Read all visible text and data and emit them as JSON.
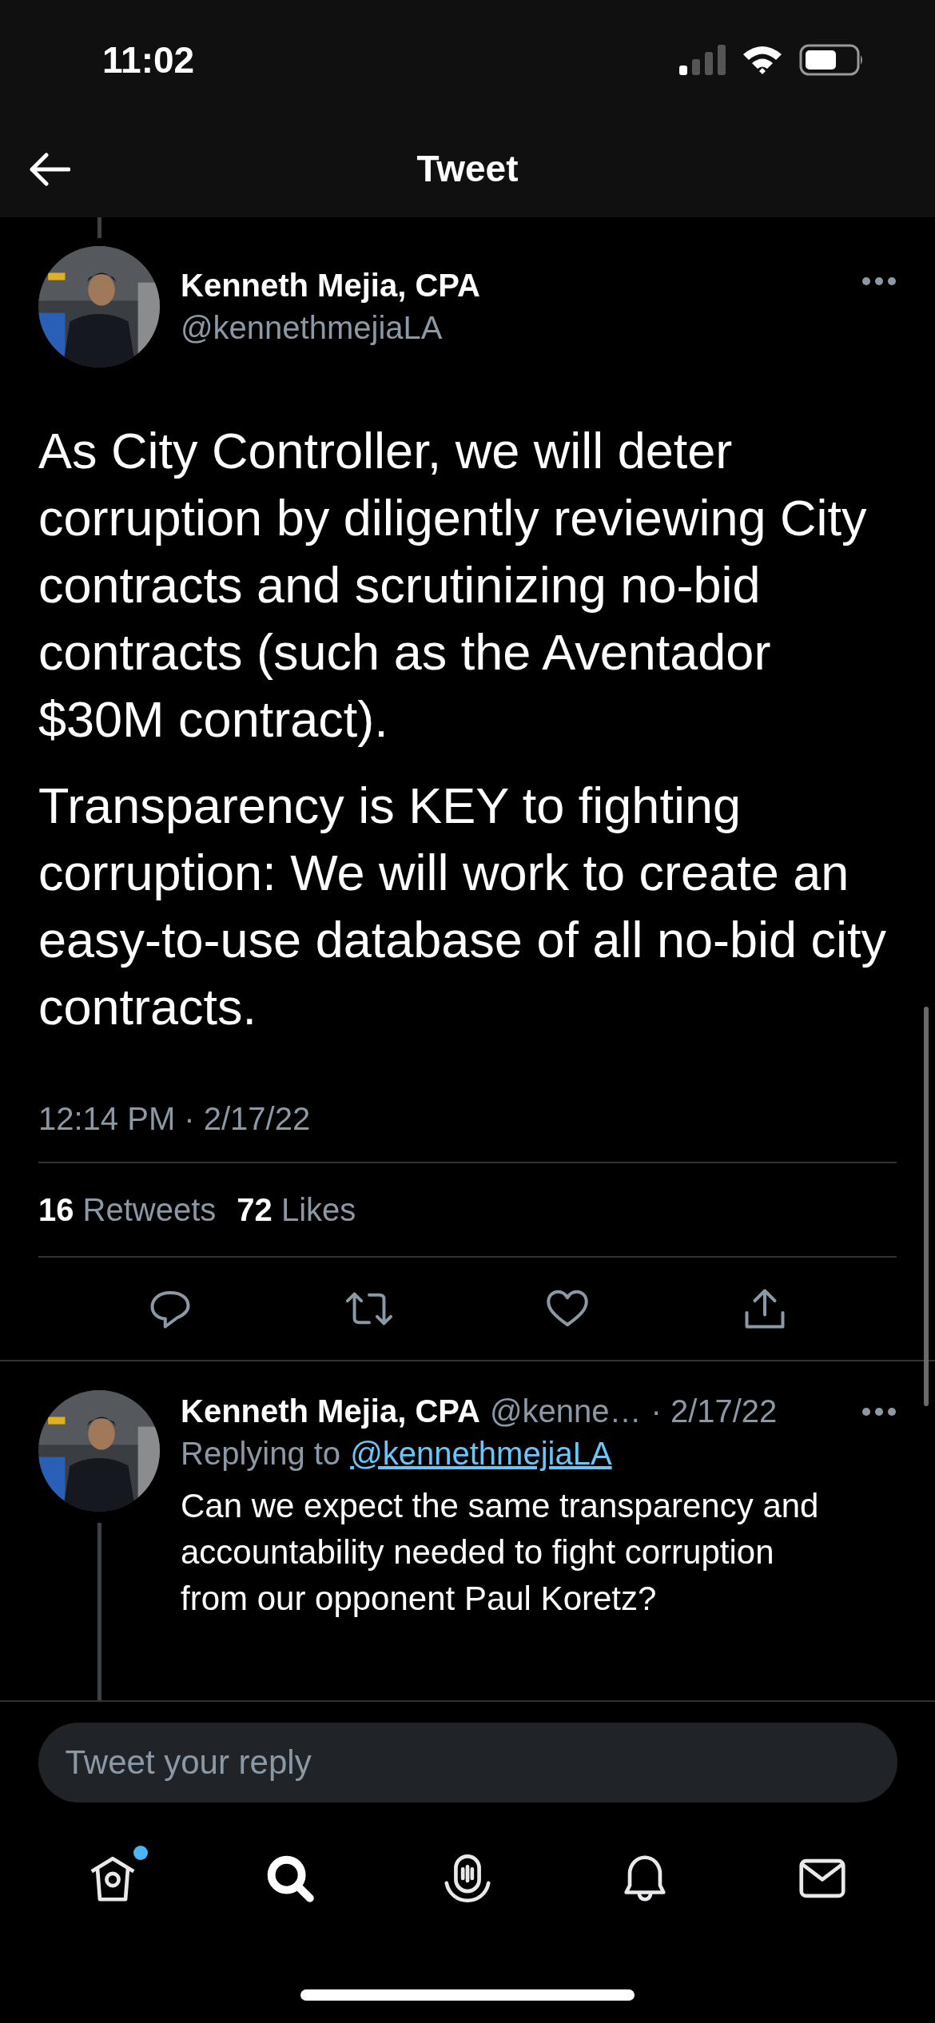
{
  "status_bar": {
    "time": "11:02"
  },
  "header": {
    "title": "Tweet"
  },
  "tweet": {
    "author": "Kenneth Mejia, CPA",
    "handle": "@kennethmejiaLA",
    "paragraphs": [
      "As City Controller, we will deter corruption by diligently reviewing City contracts and scrutinizing no-bid contracts (such as the Aventador $30M contract).",
      "Transparency is KEY to fighting corruption: We will work to create an easy-to-use database of all no-bid city contracts."
    ],
    "timestamp": "12:14 PM · 2/17/22",
    "stats": [
      {
        "count": "16",
        "label": "Retweets"
      },
      {
        "count": "72",
        "label": "Likes"
      }
    ]
  },
  "reply": {
    "author": "Kenneth Mejia, CPA",
    "handle": "@kenne…",
    "date": "· 2/17/22",
    "replying_label": "Replying to",
    "replying_to": "@kennethmejiaLA",
    "text": "Can we expect the same transparency and accountability needed to fight corruption from our opponent Paul Koretz?"
  },
  "compose": {
    "placeholder": "Tweet your reply"
  },
  "nav": [
    {
      "kind": "home",
      "selected": false,
      "badge": true
    },
    {
      "kind": "search",
      "selected": true,
      "badge": false
    },
    {
      "kind": "spaces",
      "selected": false,
      "badge": false
    },
    {
      "kind": "notifications",
      "selected": false,
      "badge": false
    },
    {
      "kind": "messages",
      "selected": false,
      "badge": false
    }
  ]
}
